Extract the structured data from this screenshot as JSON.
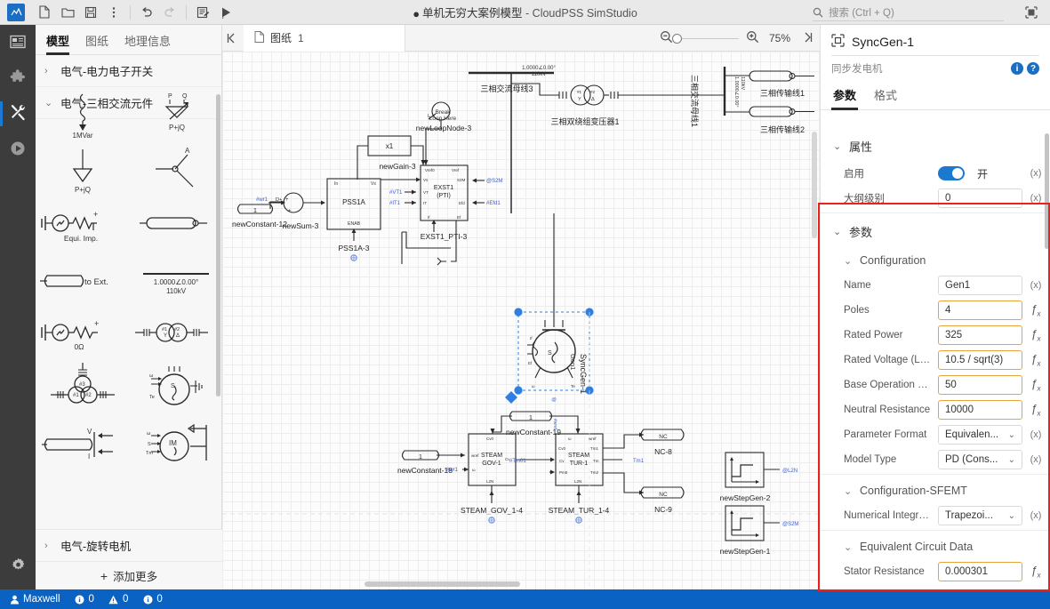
{
  "titlebar": {
    "app_logo": "app-logo",
    "tools": [
      {
        "name": "new-file-icon",
        "glyph": "new"
      },
      {
        "name": "open-folder-icon",
        "glyph": "open"
      },
      {
        "name": "save-icon",
        "glyph": "save"
      },
      {
        "name": "more-options-icon",
        "glyph": "kebab"
      },
      {
        "name": "undo-icon",
        "glyph": "undo"
      },
      {
        "name": "redo-icon",
        "glyph": "redo"
      },
      {
        "name": "script-icon",
        "glyph": "script"
      },
      {
        "name": "run-icon",
        "glyph": "run"
      }
    ],
    "modified_dot": "●",
    "document_title": "单机无穷大案例模型",
    "app_name": " - CloudPSS SimStudio",
    "search_placeholder": "搜索 (Ctrl + Q)",
    "window_button": "restore-window-icon"
  },
  "rail": {
    "items": [
      {
        "name": "sidebar-rail-explorer",
        "icon": "panel-icon",
        "active": false
      },
      {
        "name": "sidebar-rail-plugin",
        "icon": "puzzle-icon",
        "active": false
      },
      {
        "name": "sidebar-rail-tools",
        "icon": "tools-icon",
        "active": true
      },
      {
        "name": "sidebar-rail-run",
        "icon": "play-circle-icon",
        "active": false
      }
    ],
    "settings": {
      "name": "settings-gear-icon"
    }
  },
  "library": {
    "tabs": [
      {
        "label": "模型",
        "active": true
      },
      {
        "label": "图纸",
        "active": false
      },
      {
        "label": "地理信息",
        "active": false
      }
    ],
    "groups": [
      {
        "label": "电气-电力电子开关",
        "expanded": false
      },
      {
        "label": "电气-三相交流元件",
        "expanded": true
      }
    ],
    "bottom_group": {
      "label": "电气-旋转电机",
      "expanded": false
    },
    "add_more": {
      "label": "添加更多",
      "icon": "plus-icon"
    },
    "components": [
      {
        "name": "reactor-1mvar",
        "caption": "1MVar"
      },
      {
        "name": "pq-source-variable",
        "caption": "P+jQ"
      },
      {
        "name": "pq-load",
        "caption": "P+jQ"
      },
      {
        "name": "three-phase-breaker",
        "caption": "A"
      },
      {
        "name": "equivalent-impedance-source",
        "caption": "Equi. Imp."
      },
      {
        "name": "transmission-line",
        "caption": ""
      },
      {
        "name": "line-to-external",
        "caption": "to Ext."
      },
      {
        "name": "ac-bus",
        "caption": "1.0000∠0.00°\n110kV"
      },
      {
        "name": "voltage-source-0ohm",
        "caption": "0Ω"
      },
      {
        "name": "two-winding-transformer",
        "caption": ""
      },
      {
        "name": "three-winding-transformer",
        "caption": ""
      },
      {
        "name": "synchronous-machine",
        "caption": ""
      },
      {
        "name": "line-measurement-vi",
        "caption": ""
      },
      {
        "name": "induction-machine",
        "caption": "IM"
      }
    ]
  },
  "canvas": {
    "collapse_icon": "collapse-left-icon",
    "sheet_tab": {
      "icon": "sheet-icon",
      "label": "图纸",
      "number": "1"
    },
    "zoom": {
      "out_icon": "zoom-out-icon",
      "in_icon": "zoom-in-icon",
      "level": "75%",
      "fit_icon": "fit-right-icon"
    },
    "diagram": {
      "labels": [
        {
          "name": "newConstant-12",
          "text": "newConstant-12"
        },
        {
          "name": "newSum-3",
          "text": "newSum-3"
        },
        {
          "name": "pss1a-3",
          "text": "PSS1A-3"
        },
        {
          "name": "pss1a-block",
          "text": "PSS1A"
        },
        {
          "name": "newGain-3",
          "text": "newGain-3"
        },
        {
          "name": "gain-value",
          "text": "x1"
        },
        {
          "name": "newLoopNode-3",
          "text": "newLoopNode-3"
        },
        {
          "name": "break-loop-here",
          "text": "Break\nLoop Here"
        },
        {
          "name": "exst1-pti-3",
          "text": "EXST1_PTI-3"
        },
        {
          "name": "exst1-block",
          "text": "EXST1\n(PTI)"
        },
        {
          "name": "bus3",
          "text": "三相交流母线3"
        },
        {
          "name": "transformer1",
          "text": "三相双绕组变压器1"
        },
        {
          "name": "bus1",
          "text": "三相交流母线1"
        },
        {
          "name": "line1",
          "text": "三相传输线1"
        },
        {
          "name": "line2",
          "text": "三相传输线2"
        },
        {
          "name": "syncgen-1",
          "text": "SyncGen-1"
        },
        {
          "name": "gen1",
          "text": "Gen1"
        },
        {
          "name": "newConstant-18",
          "text": "newConstant-18"
        },
        {
          "name": "newConstant-19",
          "text": "newConstant-19"
        },
        {
          "name": "steam-gov-block",
          "text": "STEAM\nGOV-1"
        },
        {
          "name": "steam-gov-1-4",
          "text": "STEAM_GOV_1-4"
        },
        {
          "name": "steam-tur-block",
          "text": "STEAM\nTUR-1"
        },
        {
          "name": "steam-tur-1-4",
          "text": "STEAM_TUR_1-4"
        },
        {
          "name": "nc-8",
          "text": "NC-8"
        },
        {
          "name": "nc-9",
          "text": "NC-9"
        },
        {
          "name": "nc-label",
          "text": "NC"
        },
        {
          "name": "newStepGen-2",
          "text": "newStepGen-2"
        },
        {
          "name": "newStepGen-1",
          "text": "newStepGen-1"
        },
        {
          "name": "bus-voltage",
          "text": "1.0000∠0.00°\n110kV"
        },
        {
          "name": "signal-wr1",
          "text": "#wr1"
        },
        {
          "name": "signal-vt1",
          "text": "#VT1"
        },
        {
          "name": "signal-it1",
          "text": "#IT1"
        },
        {
          "name": "signal-s2m",
          "text": "@S2M"
        },
        {
          "name": "signal-efd1",
          "text": "#Efd1"
        },
        {
          "name": "signal-tm01",
          "text": "#Tm01"
        },
        {
          "name": "signal-tm1",
          "text": "Tm1"
        },
        {
          "name": "signal-l2n",
          "text": "@L2N"
        },
        {
          "name": "constant-one",
          "text": "1"
        }
      ]
    }
  },
  "properties": {
    "title": "SyncGen-1",
    "title_icon": "component-icon",
    "subtitle": "同步发电机",
    "info_icon": "info-icon",
    "help_icon": "help-icon",
    "tabs": [
      {
        "label": "参数",
        "active": true
      },
      {
        "label": "格式",
        "active": false
      }
    ],
    "sections": [
      {
        "name": "attributes",
        "title": "属性",
        "rows": [
          {
            "label": "启用",
            "type": "toggle",
            "value": "开",
            "suffix": "(x)"
          },
          {
            "label": "大纲级别",
            "type": "text",
            "value": "0",
            "suffix": "(x)",
            "highlight": false
          }
        ]
      },
      {
        "name": "parameters",
        "title": "参数",
        "subsections": [
          {
            "name": "configuration",
            "title": "Configuration",
            "rows": [
              {
                "label": "Name",
                "type": "text",
                "value": "Gen1",
                "suffix": "(x)",
                "highlight": false
              },
              {
                "label": "Poles",
                "type": "text",
                "value": "4",
                "suffix": "fx",
                "highlight": true
              },
              {
                "label": "Rated Power",
                "type": "text",
                "value": "325",
                "suffix": "fx",
                "highlight": true
              },
              {
                "label": "Rated Voltage (L-G,...",
                "type": "text",
                "value": "10.5 / sqrt(3)",
                "suffix": "fx",
                "highlight": true
              },
              {
                "label": "Base Operation Fre...",
                "type": "text",
                "value": "50",
                "suffix": "fx",
                "highlight": true
              },
              {
                "label": "Neutral Resistance",
                "type": "text",
                "value": "10000",
                "suffix": "fx",
                "highlight": true
              },
              {
                "label": "Parameter Format",
                "type": "select",
                "value": "Equivalen...",
                "suffix": "(x)",
                "highlight": false
              },
              {
                "label": "Model Type",
                "type": "select",
                "value": "PD (Cons...",
                "suffix": "(x)",
                "highlight": false
              }
            ]
          },
          {
            "name": "configuration-sfemt",
            "title": "Configuration-SFEMT",
            "rows": [
              {
                "label": "Numerical Integrati...",
                "type": "select",
                "value": "Trapezoi...",
                "suffix": "(x)",
                "highlight": false
              }
            ]
          },
          {
            "name": "equivalent-circuit-data",
            "title": "Equivalent Circuit Data",
            "rows": [
              {
                "label": "Stator Resistance",
                "type": "text",
                "value": "0.000301",
                "suffix": "fx",
                "highlight": true
              }
            ]
          }
        ]
      }
    ],
    "highlight_color": "#e8231c"
  },
  "statusbar": {
    "user_icon": "user-icon",
    "user": "Maxwell",
    "counters": [
      {
        "name": "info-count",
        "icon": "info-icon",
        "value": "0"
      },
      {
        "name": "warning-count",
        "icon": "warning-icon",
        "value": "0"
      },
      {
        "name": "error-count",
        "icon": "error-icon",
        "value": "0"
      }
    ],
    "accent": "#0a63c2"
  }
}
